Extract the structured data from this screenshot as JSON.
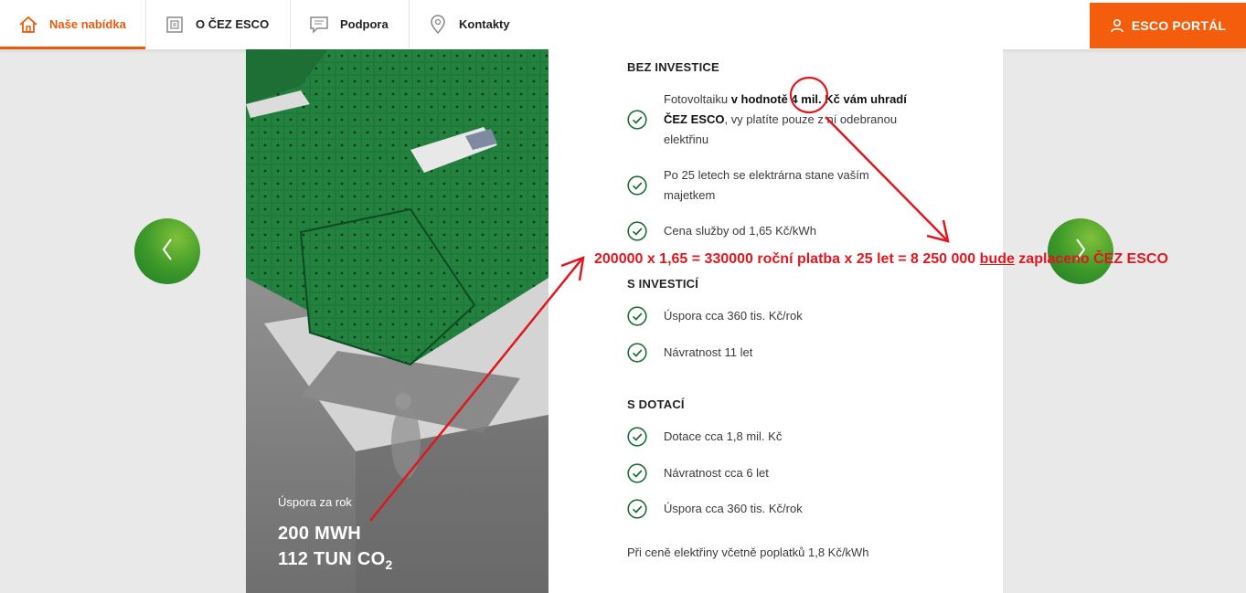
{
  "nav": {
    "items": [
      {
        "label": "Naše nabídka",
        "icon": "home-icon",
        "active": true
      },
      {
        "label": "O ČEZ ESCO",
        "icon": "document-icon",
        "active": false
      },
      {
        "label": "Podpora",
        "icon": "chat-icon",
        "active": false
      },
      {
        "label": "Kontakty",
        "icon": "location-pin-icon",
        "active": false
      }
    ],
    "portal_label": "ESCO PORTÁL",
    "portal_icon": "user-icon"
  },
  "photo": {
    "caption": "Úspora za rok",
    "stat1": "200 MWH",
    "stat2_prefix": "112 TUN CO",
    "stat2_sub": "2"
  },
  "sections": {
    "bez_investice": {
      "title": "BEZ INVESTICE",
      "item1": {
        "t1": "Fotovoltaiku ",
        "b1": "v hodnotě 4 mil. Kč vám uhradí ČEZ ESCO",
        "t2": ", vy platíte pouze z ní odebranou elektřinu"
      },
      "item2": "Po 25 letech se elektrárna stane vaším majetkem",
      "item3": "Cena služby od 1,65 Kč/kWh"
    },
    "s_investici": {
      "title": "S INVESTICÍ",
      "items": [
        "Úspora cca 360 tis. Kč/rok",
        "Návratnost 11 let"
      ]
    },
    "s_dotaci": {
      "title": "S DOTACÍ",
      "items": [
        "Dotace cca 1,8 mil. Kč",
        "Návratnost cca 6 let",
        "Úspora cca 360 tis. Kč/rok"
      ]
    },
    "footnote": "Při ceně elektřiny včetně poplatků 1,8 Kč/kWh"
  },
  "annotation": {
    "part1": "200000 x 1,65 = 330000 roční platba x 25 let = 8 250 000 ",
    "underlined": "bude",
    "part2": " zaplaceno ČEZ ESCO"
  },
  "colors": {
    "accent": "#f45d0c",
    "check_green": "#1d6b3a",
    "arrow_green": "#3f9a2a",
    "annotation_red": "#e0171f"
  }
}
